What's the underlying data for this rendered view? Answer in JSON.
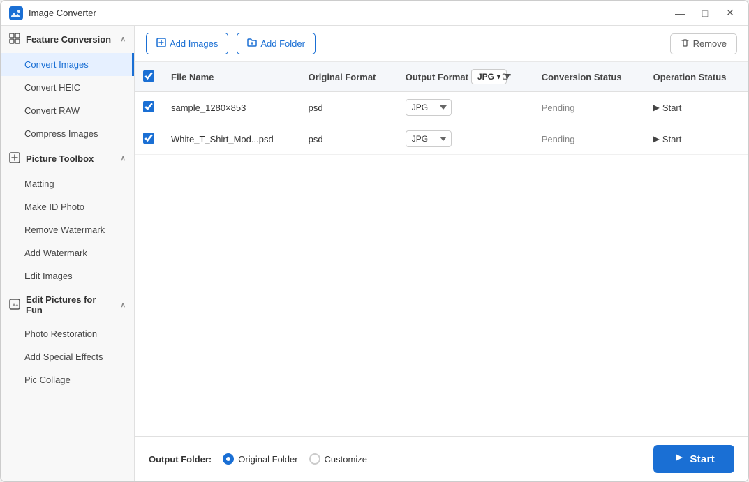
{
  "titleBar": {
    "title": "Image Converter",
    "controls": {
      "minimize": "—",
      "maximize": "□",
      "close": "✕"
    }
  },
  "sidebar": {
    "sections": [
      {
        "id": "feature-conversion",
        "label": "Feature Conversion",
        "icon": "⊕",
        "expanded": true,
        "items": [
          {
            "id": "convert-images",
            "label": "Convert Images",
            "active": true
          },
          {
            "id": "convert-heic",
            "label": "Convert HEIC",
            "active": false
          },
          {
            "id": "convert-raw",
            "label": "Convert RAW",
            "active": false
          },
          {
            "id": "compress-images",
            "label": "Compress Images",
            "active": false
          }
        ]
      },
      {
        "id": "picture-toolbox",
        "label": "Picture Toolbox",
        "icon": "⊞",
        "expanded": true,
        "items": [
          {
            "id": "matting",
            "label": "Matting",
            "active": false
          },
          {
            "id": "make-id-photo",
            "label": "Make ID Photo",
            "active": false
          },
          {
            "id": "remove-watermark",
            "label": "Remove Watermark",
            "active": false
          },
          {
            "id": "add-watermark",
            "label": "Add Watermark",
            "active": false
          },
          {
            "id": "edit-images",
            "label": "Edit Images",
            "active": false
          }
        ]
      },
      {
        "id": "edit-pictures-for-fun",
        "label": "Edit Pictures for Fun",
        "icon": "⊡",
        "expanded": true,
        "items": [
          {
            "id": "photo-restoration",
            "label": "Photo Restoration",
            "active": false
          },
          {
            "id": "add-special-effects",
            "label": "Add Special Effects",
            "active": false
          },
          {
            "id": "pic-collage",
            "label": "Pic Collage",
            "active": false
          }
        ]
      }
    ]
  },
  "toolbar": {
    "addImages": "Add Images",
    "addFolder": "Add Folder",
    "remove": "Remove"
  },
  "table": {
    "headers": {
      "fileName": "File Name",
      "originalFormat": "Original Format",
      "outputFormat": "Output Format",
      "formatValue": "JPG",
      "conversionStatus": "Conversion Status",
      "operationStatus": "Operation Status"
    },
    "rows": [
      {
        "id": "row1",
        "checked": true,
        "fileName": "sample_1280×853",
        "originalFormat": "psd",
        "outputFormat": "JPG",
        "conversionStatus": "Pending",
        "operationStatus": "Start"
      },
      {
        "id": "row2",
        "checked": true,
        "fileName": "White_T_Shirt_Mod...psd",
        "originalFormat": "psd",
        "outputFormat": "JPG",
        "conversionStatus": "Pending",
        "operationStatus": "Start"
      }
    ]
  },
  "bottomBar": {
    "outputFolderLabel": "Output Folder:",
    "originalFolderLabel": "Original Folder",
    "customizeLabel": "Customize",
    "startButtonLabel": "Start"
  },
  "icons": {
    "addImages": "🖼",
    "addFolder": "📁",
    "remove": "🗑",
    "play": "▶",
    "chevronDown": "∨",
    "chevronRight": "›"
  }
}
